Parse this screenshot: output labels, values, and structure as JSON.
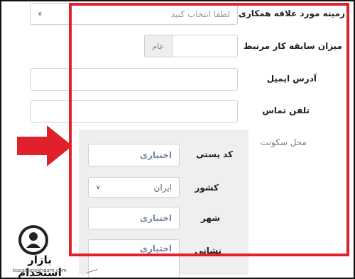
{
  "form": {
    "field_of_interest": {
      "label": "زمینه مورد علاقه همکاری",
      "value": "لطفا انتخاب کنید"
    },
    "experience": {
      "label": "میزان سابقه کار مرتبط",
      "addon": "عام"
    },
    "email": {
      "label": "آدرس ایمیل"
    },
    "phone": {
      "label": "تلفن تماس"
    },
    "residence": {
      "label": "محل سکونت"
    },
    "postal_code": {
      "label": "کد پستی",
      "placeholder": "اختیاری"
    },
    "country": {
      "label": "کشور",
      "value": "ایران"
    },
    "city": {
      "label": "شهر",
      "placeholder": "اختیاری"
    },
    "address": {
      "label": "نشانی",
      "placeholder": "اختیاری"
    }
  },
  "watermark": {
    "brand": "بازار استخدام",
    "site": "bazarestekhdam.com"
  },
  "colors": {
    "highlight_red": "#e0202a",
    "placeholder_blue": "#7a86a8"
  },
  "icons": {
    "arrow": "red-right-arrow-icon",
    "select": "chevron-down-icon",
    "logo": "search-person-icon"
  }
}
